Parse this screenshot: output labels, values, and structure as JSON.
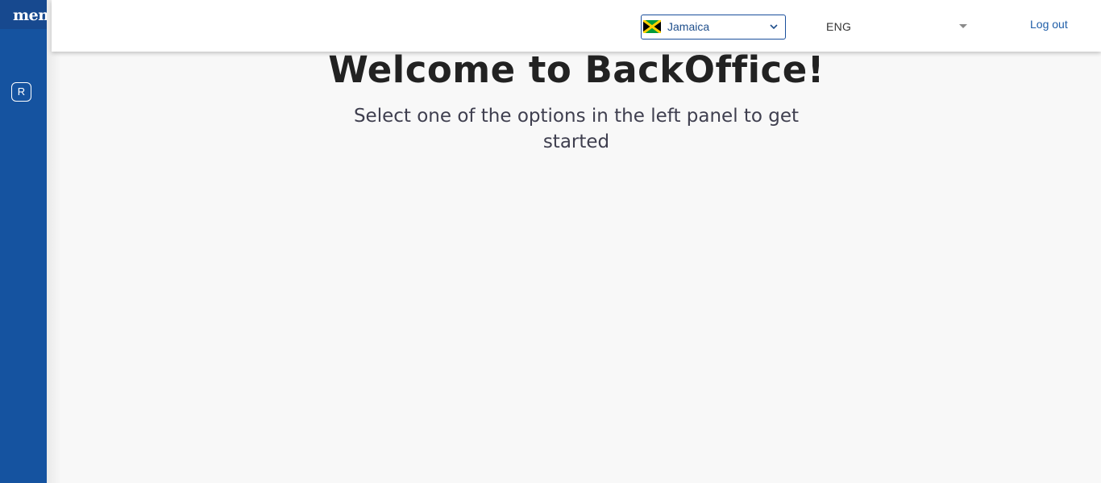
{
  "sidebar": {
    "logo_text": "menu",
    "items": [
      {
        "label": "R",
        "icon": "r-letter-icon"
      }
    ]
  },
  "header": {
    "country": {
      "selected": "Jamaica",
      "flag_icon": "jamaica-flag-icon"
    },
    "language": {
      "selected": "ENG"
    },
    "logout_label": "Log out"
  },
  "main": {
    "title": "Welcome to BackOffice!",
    "subtitle": "Select one of the options in the left panel to get started"
  },
  "colors": {
    "sidebar_bg": "#1553a0",
    "accent": "#1f5ea8",
    "page_bg": "#f8f8f8"
  }
}
